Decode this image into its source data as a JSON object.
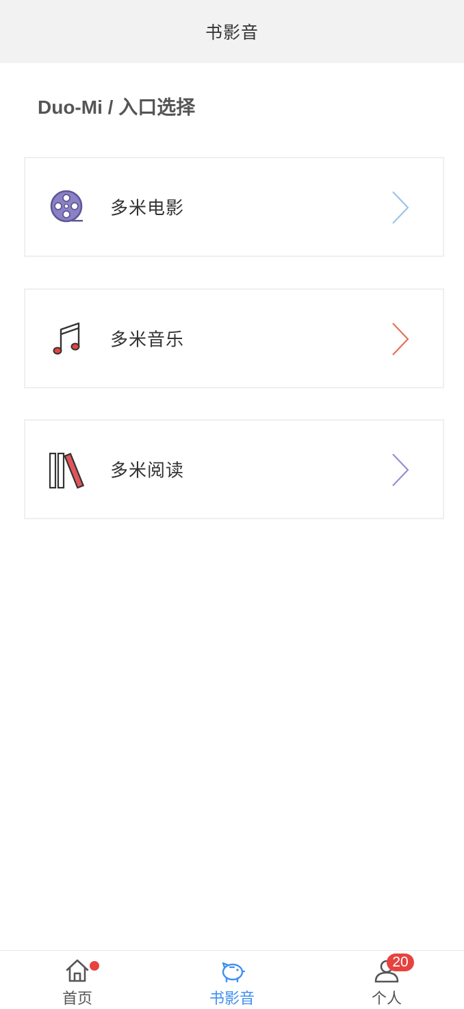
{
  "header": {
    "title": "书影音"
  },
  "section": {
    "title": "Duo-Mi / 入口选择"
  },
  "entries": [
    {
      "label": "多米电影",
      "icon": "film-reel-icon",
      "chevron_color": "#9cc3ea"
    },
    {
      "label": "多米音乐",
      "icon": "music-note-icon",
      "chevron_color": "#e57158"
    },
    {
      "label": "多米阅读",
      "icon": "books-icon",
      "chevron_color": "#9b8bd0"
    }
  ],
  "tabbar": {
    "tabs": [
      {
        "label": "首页",
        "icon": "home-icon",
        "active": false,
        "has_dot": true
      },
      {
        "label": "书影音",
        "icon": "piggy-bank-icon",
        "active": true
      },
      {
        "label": "个人",
        "icon": "user-icon",
        "active": false,
        "badge": "20"
      }
    ]
  },
  "colors": {
    "header_bg": "#f2f2f2",
    "active_tab": "#3f8ff0",
    "badge": "#e64340",
    "film_icon": "#7b72b8",
    "note_dot": "#e64340",
    "book_red": "#e0545a"
  }
}
